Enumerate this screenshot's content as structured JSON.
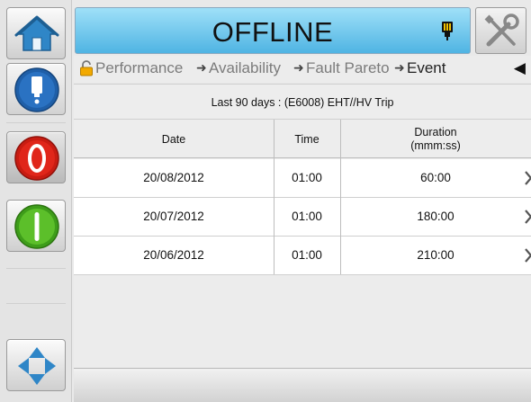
{
  "status": {
    "text": "OFFLINE"
  },
  "breadcrumb": {
    "items": [
      {
        "label": "Performance"
      },
      {
        "label": "Availability"
      },
      {
        "label": "Fault Pareto"
      },
      {
        "label": "Event"
      }
    ],
    "separator": "➜"
  },
  "report": {
    "subtitle": "Last 90 days : (E6008) EHT//HV Trip",
    "columns": {
      "date": "Date",
      "time": "Time",
      "duration": "Duration",
      "duration_unit": "(mmm:ss)"
    },
    "rows": [
      {
        "date": "20/08/2012",
        "time": "01:00",
        "duration": "60:00"
      },
      {
        "date": "20/07/2012",
        "time": "01:00",
        "duration": "180:00"
      },
      {
        "date": "20/06/2012",
        "time": "01:00",
        "duration": "210:00"
      }
    ]
  },
  "colors": {
    "status_bar": "#5ab9e6",
    "stop_button": "#e0261a",
    "start_button": "#5cbf2a",
    "info_button": "#1f5fa8"
  }
}
